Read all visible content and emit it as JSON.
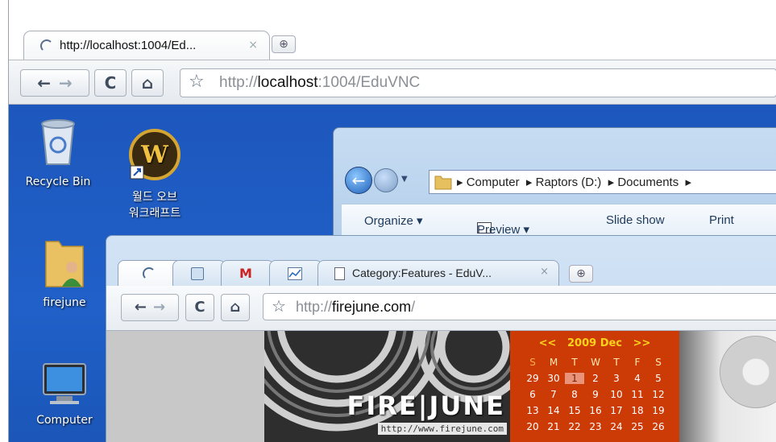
{
  "outer_browser": {
    "tab_title": "http://localhost:1004/Ed...",
    "tab_close": "×",
    "new_tab": "⊕",
    "nav": {
      "back": "←",
      "forward": "→",
      "reload": "C",
      "home": "⌂",
      "star": "☆"
    },
    "url_prefix": "http://",
    "url_host": "localhost",
    "url_rest": ":1004/EduVNC"
  },
  "desktop": {
    "icons": [
      {
        "label": "Recycle Bin"
      },
      {
        "label": "월드 오브\n워크래프트"
      },
      {
        "label": "firejune"
      },
      {
        "label": "Computer"
      }
    ]
  },
  "explorer": {
    "breadcrumb": [
      "Computer",
      "Raptors (D:)",
      "Documents"
    ],
    "commands": {
      "organize": "Organize ▾",
      "preview": "Preview ▾",
      "slideshow": "Slide show",
      "print": "Print"
    }
  },
  "inner_browser": {
    "tab_title": "Category:Features - EduV...",
    "tab_close": "×",
    "new_tab": "⊕",
    "url_prefix": "http://",
    "url_host": "firejune.com",
    "url_rest": "/",
    "nav": {
      "back": "←",
      "forward": "→",
      "reload": "C",
      "home": "⌂",
      "star": "☆"
    }
  },
  "page": {
    "banner_logo": "FIRE|JUNE",
    "banner_url": "http://www.firejune.com",
    "calendar": {
      "prev": "<<",
      "month": "2009 Dec",
      "next": ">>",
      "weekdays": [
        "S",
        "M",
        "T",
        "W",
        "T",
        "F",
        "S"
      ],
      "rows": [
        [
          "29",
          "30",
          "1",
          "2",
          "3",
          "4",
          "5"
        ],
        [
          "6",
          "7",
          "8",
          "9",
          "10",
          "11",
          "12"
        ],
        [
          "13",
          "14",
          "15",
          "16",
          "17",
          "18",
          "19"
        ],
        [
          "20",
          "21",
          "22",
          "23",
          "24",
          "25",
          "26"
        ]
      ],
      "today": "1",
      "colors": {
        "bg": "#cc3a06",
        "header": "#ffd21a",
        "today": "#e8937a"
      }
    }
  }
}
